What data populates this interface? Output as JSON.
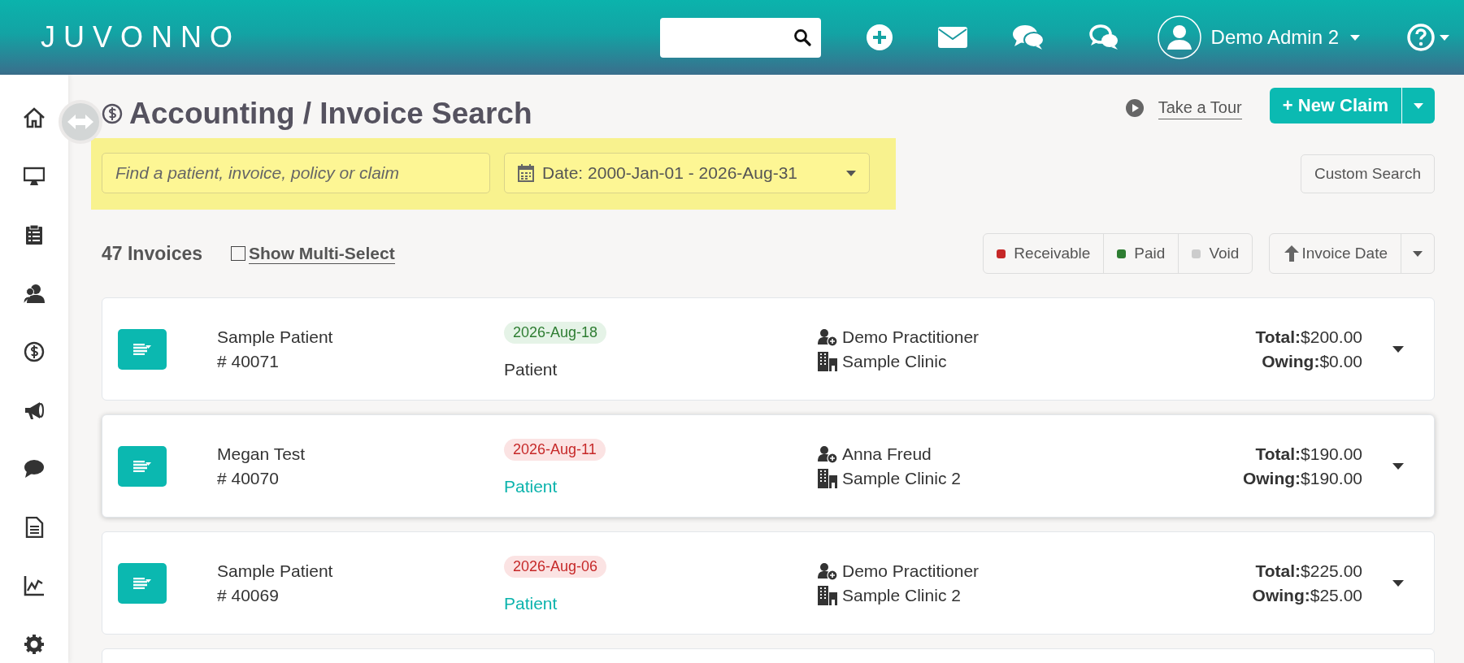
{
  "header": {
    "logo": "JUVONNO",
    "user_name": "Demo Admin 2"
  },
  "page": {
    "title": "Accounting / Invoice Search",
    "tour_link": "Take a Tour",
    "new_claim_button": "+ New Claim",
    "search": {
      "placeholder": "Find a patient, invoice, policy or claim"
    },
    "date_filter": "Date: 2000-Jan-01 - 2026-Aug-31",
    "custom_search_button": "Custom Search",
    "invoice_count": "47 Invoices",
    "multi_select": {
      "label": "Show Multi-Select",
      "checked": false
    },
    "status_filters": [
      {
        "label": "Receivable",
        "color": "#c62828"
      },
      {
        "label": "Paid",
        "color": "#2e7d32"
      },
      {
        "label": "Void",
        "color": "#cccccc"
      }
    ],
    "sort": {
      "label": "Invoice Date",
      "ascending": true
    }
  },
  "invoices": [
    {
      "patient": "Sample Patient",
      "number": "# 40071",
      "date": "2026-Aug-18",
      "paid": true,
      "type": "Patient",
      "practitioner": "Demo Practitioner",
      "clinic": "Sample Clinic",
      "total_label": "Total:",
      "total": "$200.00",
      "owing_label": "Owing:",
      "owing": "$0.00",
      "highlighted": false
    },
    {
      "patient": "Megan Test",
      "number": "# 40070",
      "date": "2026-Aug-11",
      "paid": false,
      "type": "Patient",
      "practitioner": "Anna Freud",
      "clinic": "Sample Clinic 2",
      "total_label": "Total:",
      "total": "$190.00",
      "owing_label": "Owing:",
      "owing": "$190.00",
      "highlighted": true
    },
    {
      "patient": "Sample Patient",
      "number": "# 40069",
      "date": "2026-Aug-06",
      "paid": false,
      "type": "Patient",
      "practitioner": "Demo Practitioner",
      "clinic": "Sample Clinic 2",
      "total_label": "Total:",
      "total": "$225.00",
      "owing_label": "Owing:",
      "owing": "$25.00",
      "highlighted": false
    }
  ]
}
